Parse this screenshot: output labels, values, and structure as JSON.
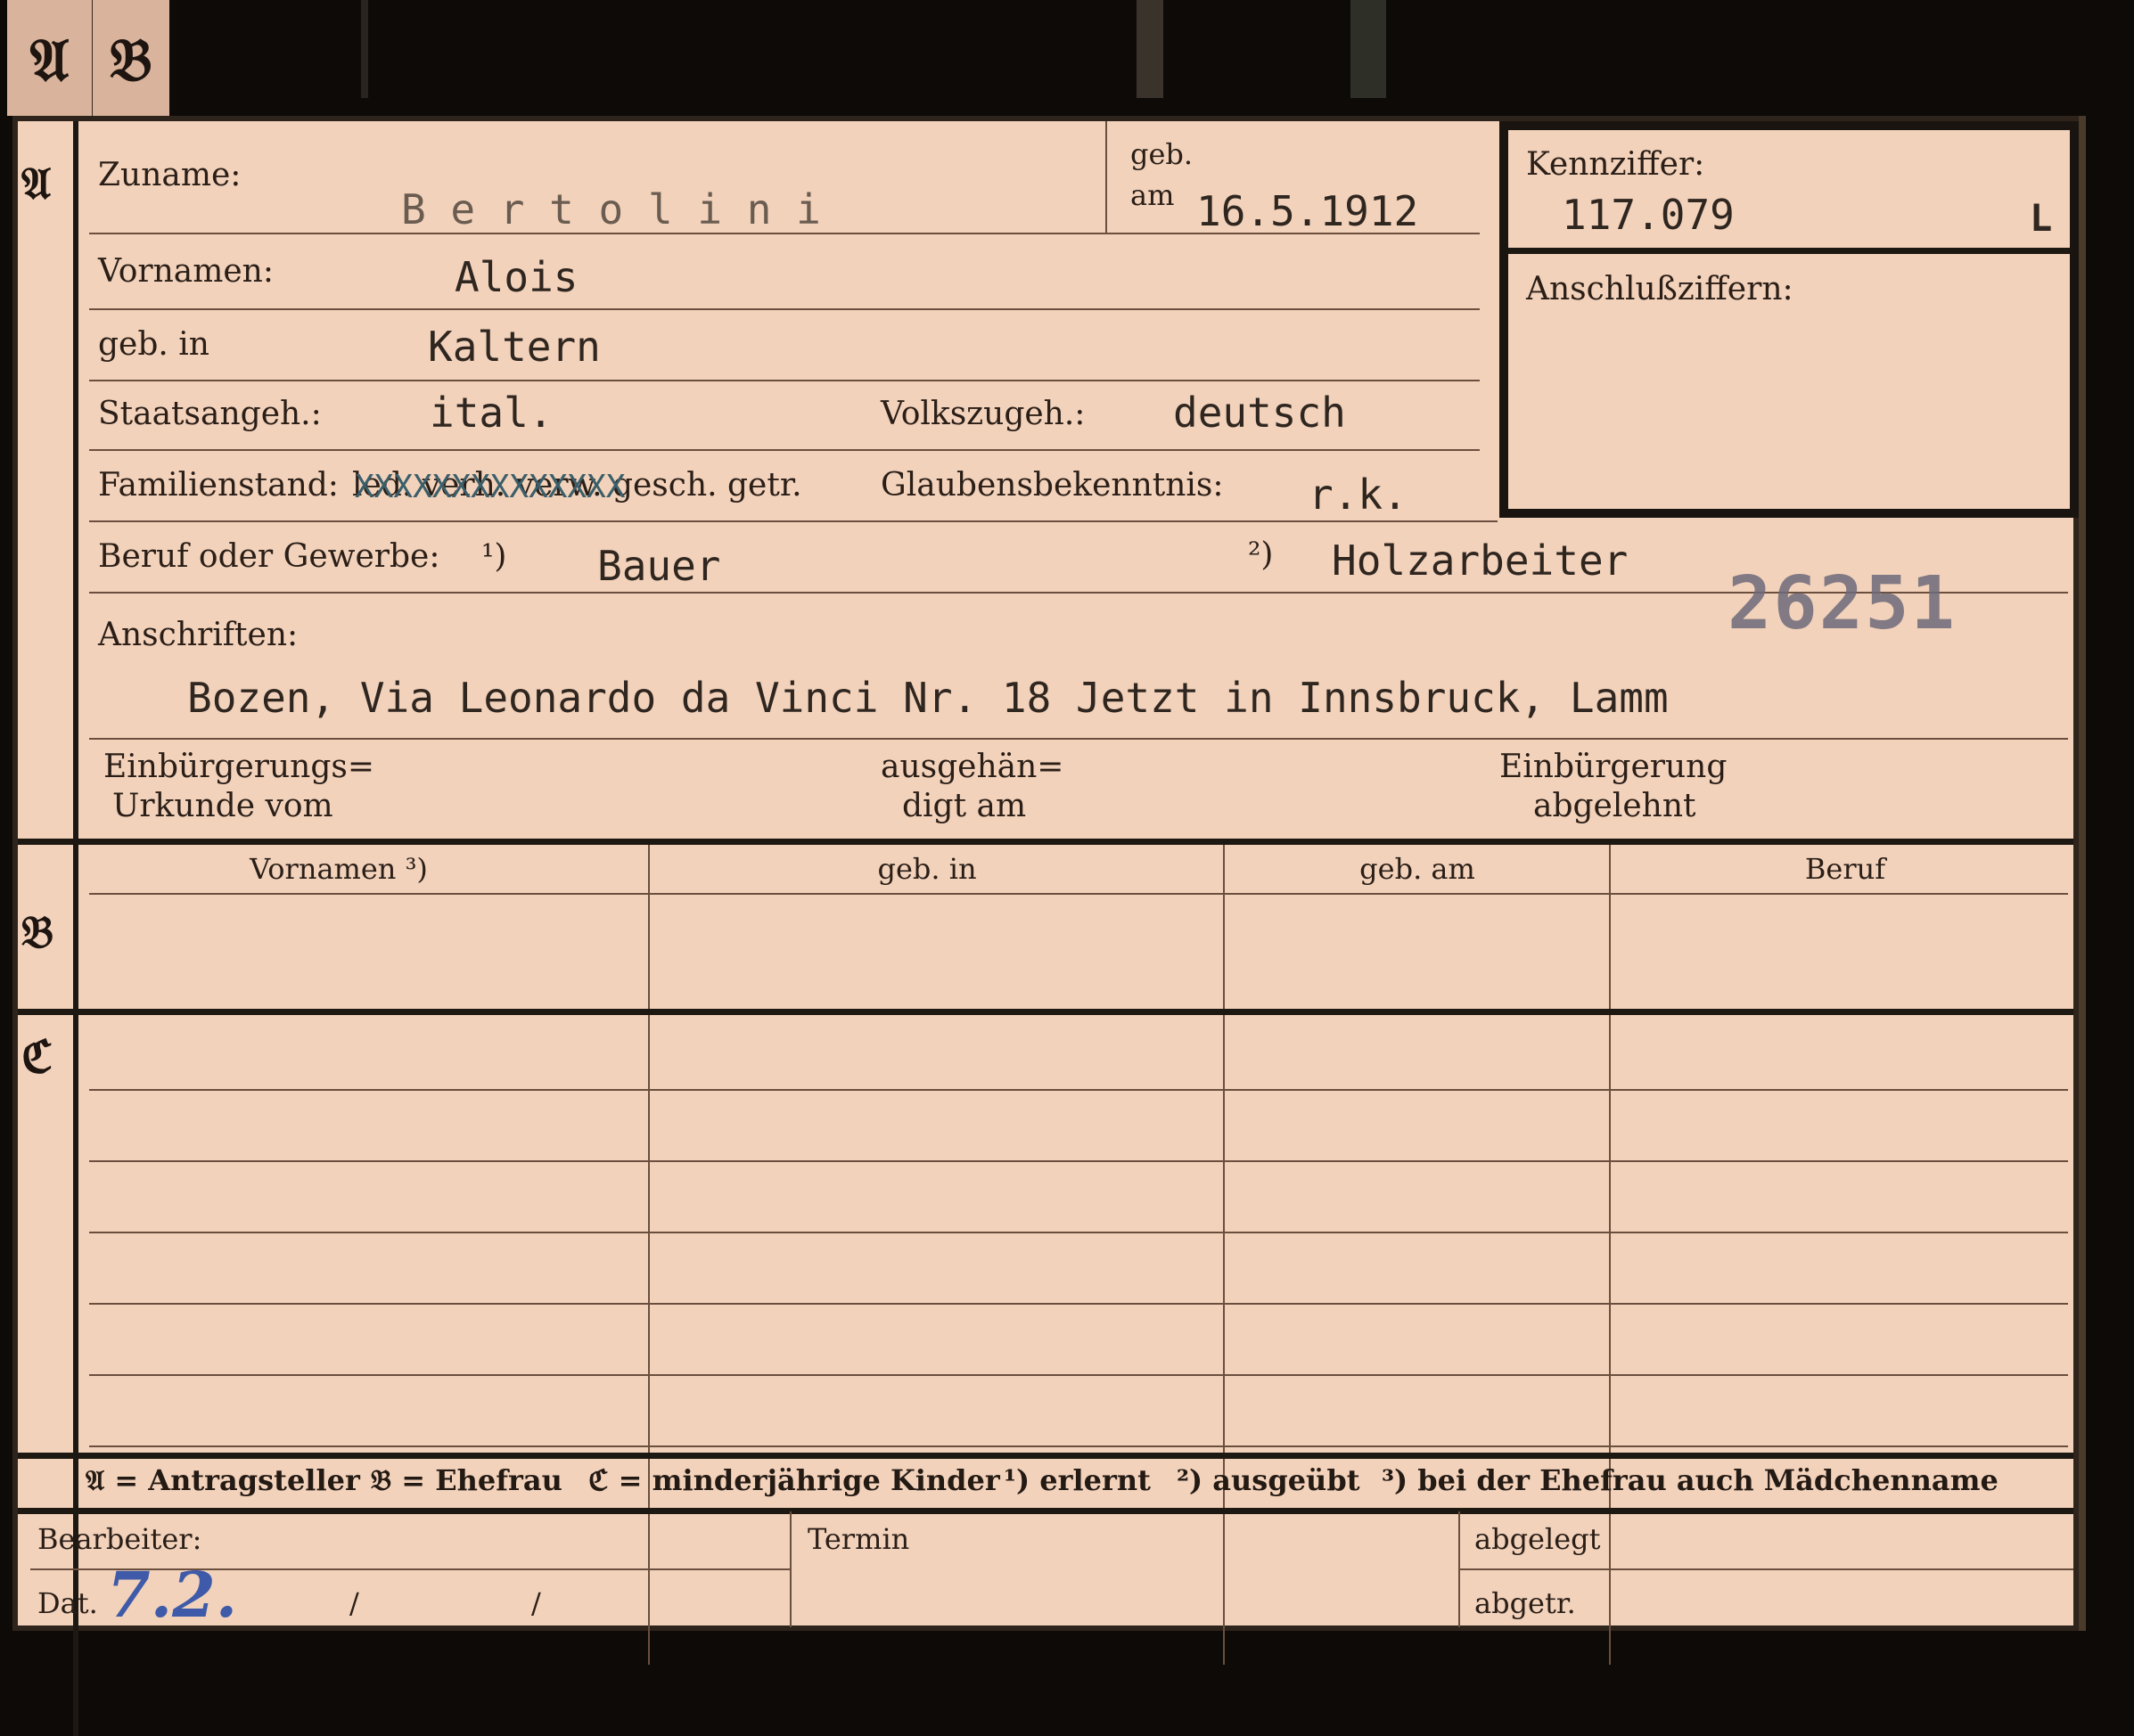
{
  "tabs": {
    "a": "𝔄",
    "b": "𝔅"
  },
  "section_letters": {
    "a": "𝔄",
    "b": "𝔅",
    "c": "ℭ"
  },
  "labels": {
    "zuname": "Zuname:",
    "geb": "geb.",
    "am": "am",
    "kennziffer": "Kennziffer:",
    "anschlussziffern": "Anschlußziffern:",
    "vornamen": "Vornamen:",
    "geb_in": "geb. in",
    "staatsangeh": "Staatsangeh.:",
    "volkszugeh": "Volkszugeh.:",
    "familienstand": "Familienstand:",
    "familienstand_options": "led. verh. verw. gesch. getr.",
    "glaubensbekenntnis": "Glaubensbekenntnis:",
    "beruf": "Beruf oder Gewerbe:",
    "beruf_note1": "¹)",
    "beruf_note2": "²)",
    "anschriften": "Anschriften:",
    "einbuergerungs_1": "Einbürgerungs=",
    "einbuergerungs_2": "Urkunde vom",
    "ausgehaen_1": "ausgehän=",
    "ausgehaen_2": "digt am",
    "einbuergerung_1": "Einbürgerung",
    "einbuergerung_2": "abgelehnt",
    "bearbeiter": "Bearbeiter:",
    "dat": "Dat.",
    "dat_sep1": "/",
    "dat_sep2": "/",
    "termin": "Termin",
    "abgelegt": "abgelegt",
    "abgetr": "abgetr."
  },
  "values": {
    "zuname": "B e r t o l i n i",
    "geb_am": "16.5.1912",
    "kennziffer": "117.079",
    "kennziffer_suffix": "L",
    "vornamen": "Alois",
    "geb_in": "Kaltern",
    "staatsangeh": "ital.",
    "volkszugeh": "deutsch",
    "familienstand_strikeout": "XXXXXXXXXXXXXX",
    "glaubensbekenntnis": "r.k.",
    "beruf_erlernt": "Bauer",
    "beruf_ausgeuebt": "Holzarbeiter",
    "stamp_number": "26251",
    "anschrift": "Bozen, Via Leonardo da Vinci Nr. 18 Jetzt in Innsbruck, Lamm",
    "dat_handwritten": "7.2."
  },
  "table_headers": [
    "Vornamen ³)",
    "geb. in",
    "geb. am",
    "Beruf"
  ],
  "legend": {
    "a": "𝔄 = Antragsteller",
    "b": "𝔅 = Ehefrau",
    "c": "ℭ = minderjährige Kinder",
    "n1": "¹) erlernt",
    "n2": "²) ausgeübt",
    "n3": "³) bei der Ehefrau auch Mädchenname"
  }
}
